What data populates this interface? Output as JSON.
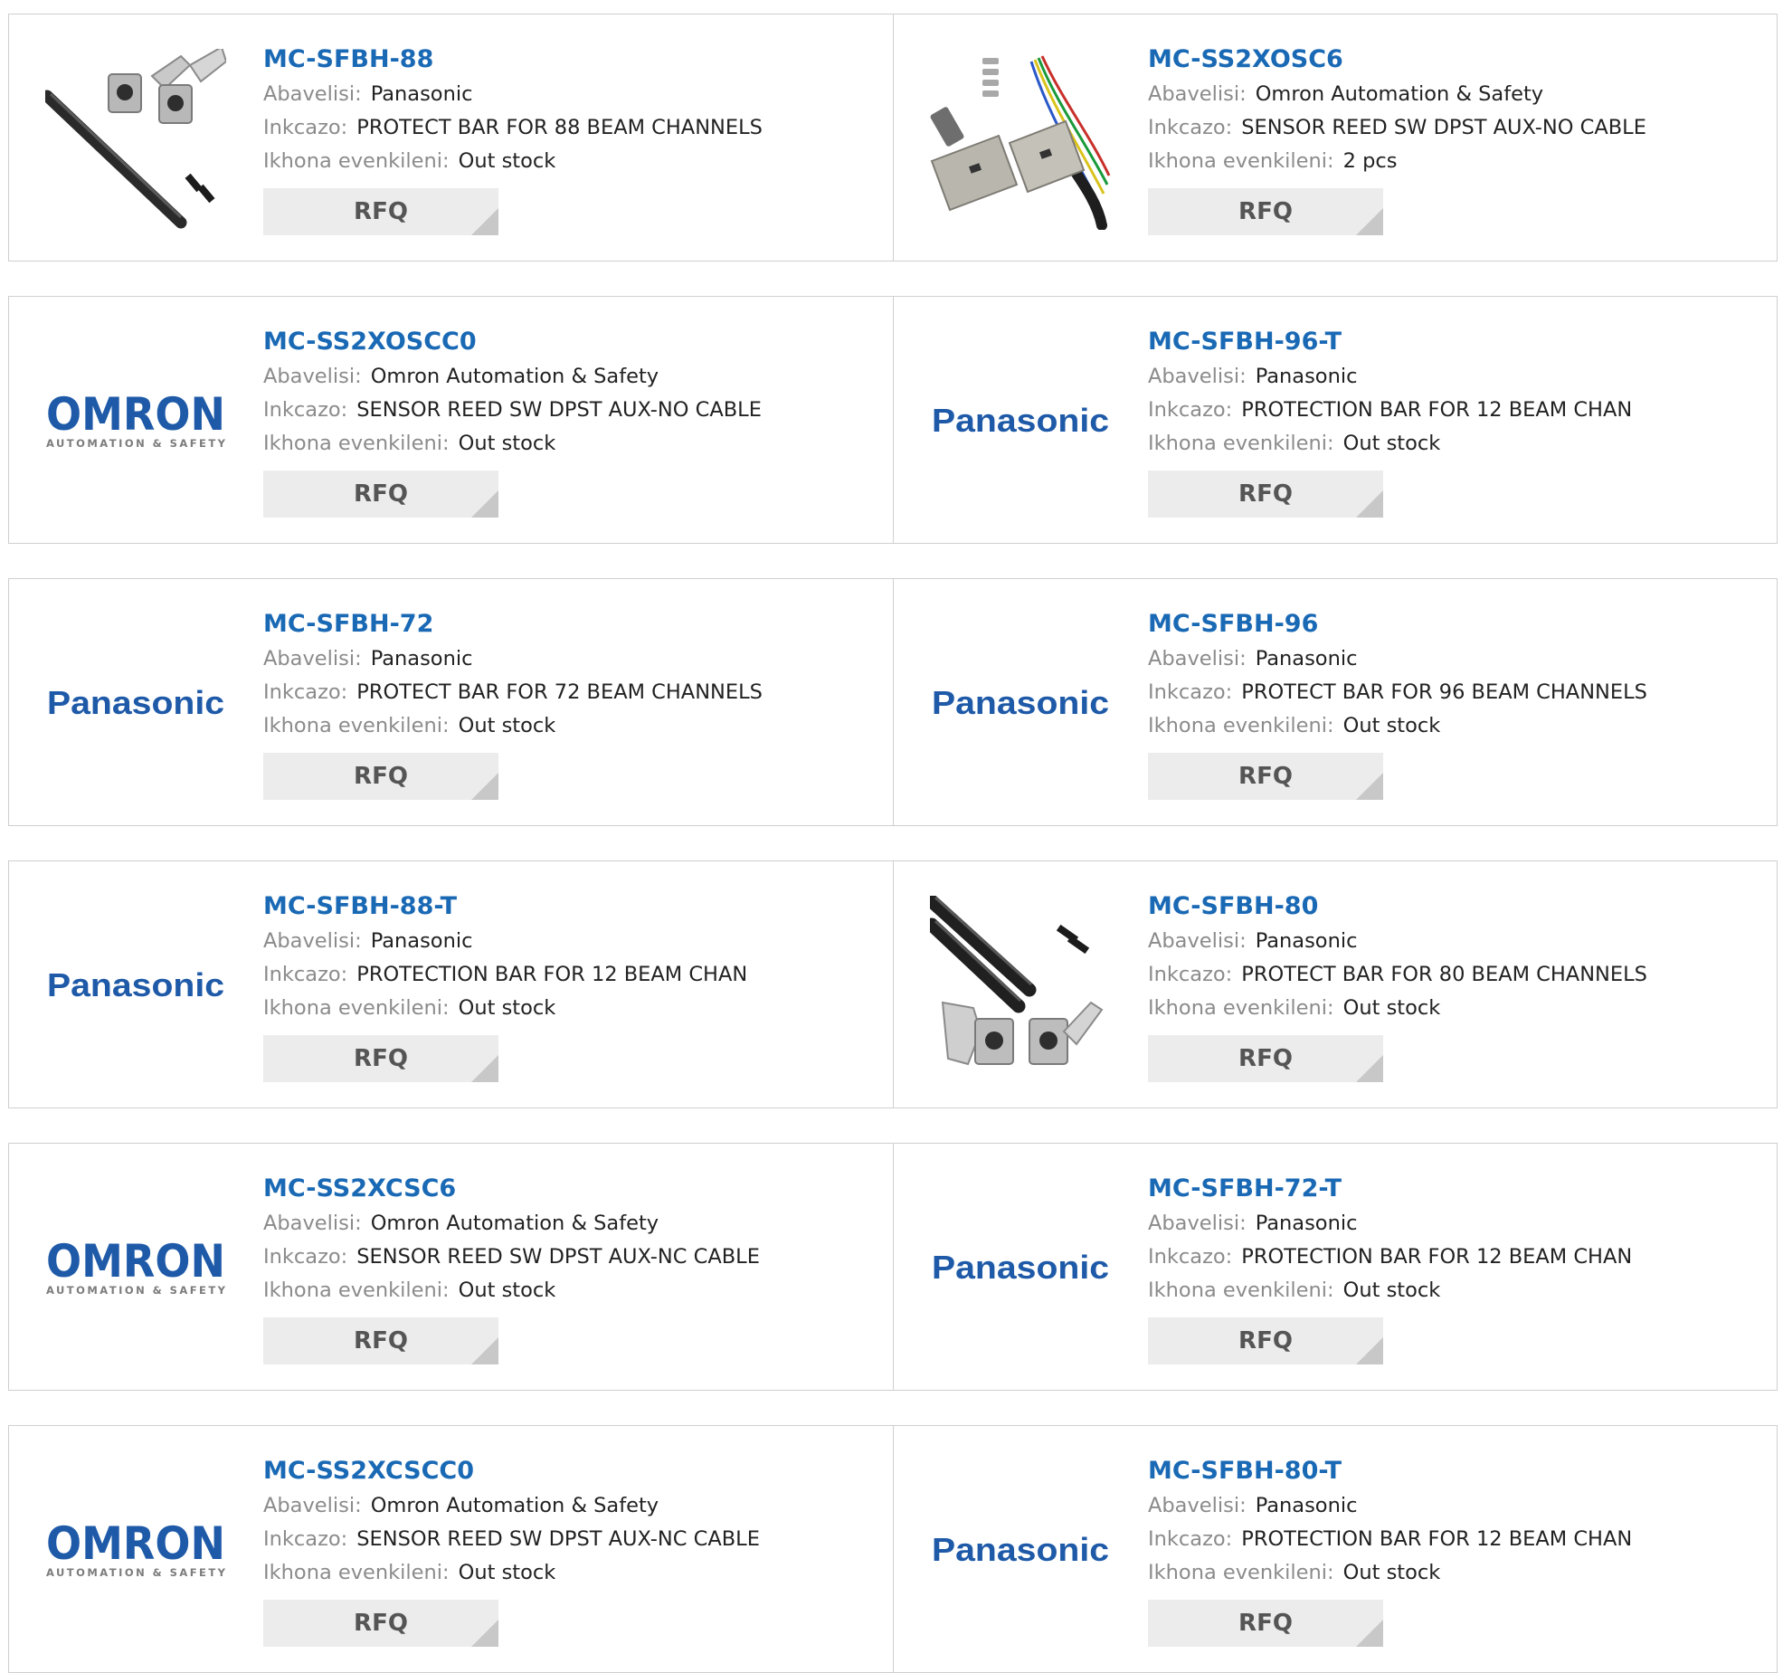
{
  "labels": {
    "manufacturer": "Abavelisi:",
    "description": "Inkcazo:",
    "stock": "Ikhona evenkileni:",
    "rfq": "RFQ"
  },
  "brand_logos": {
    "omron": {
      "name": "OMRON",
      "tagline": "AUTOMATION & SAFETY",
      "color": "#1e5aa8"
    },
    "panasonic": {
      "name": "Panasonic",
      "color": "#1e5aa8"
    }
  },
  "products": [
    {
      "part_number": "MC-SFBH-88",
      "manufacturer": "Panasonic",
      "description": "PROTECT BAR FOR 88 BEAM CHANNELS",
      "stock": "Out stock",
      "image": "bar-photo"
    },
    {
      "part_number": "MC-SS2XOSC6",
      "manufacturer": "Omron Automation & Safety",
      "description": "SENSOR REED SW DPST AUX-NO CABLE",
      "stock": "2 pcs",
      "image": "sensor-photo"
    },
    {
      "part_number": "MC-SS2XOSCC0",
      "manufacturer": "Omron Automation & Safety",
      "description": "SENSOR REED SW DPST AUX-NO CABLE",
      "stock": "Out stock",
      "image": "omron"
    },
    {
      "part_number": "MC-SFBH-96-T",
      "manufacturer": "Panasonic",
      "description": "PROTECTION BAR FOR 12 BEAM CHAN",
      "stock": "Out stock",
      "image": "panasonic"
    },
    {
      "part_number": "MC-SFBH-72",
      "manufacturer": "Panasonic",
      "description": "PROTECT BAR FOR 72 BEAM CHANNELS",
      "stock": "Out stock",
      "image": "panasonic"
    },
    {
      "part_number": "MC-SFBH-96",
      "manufacturer": "Panasonic",
      "description": "PROTECT BAR FOR 96 BEAM CHANNELS",
      "stock": "Out stock",
      "image": "panasonic"
    },
    {
      "part_number": "MC-SFBH-88-T",
      "manufacturer": "Panasonic",
      "description": "PROTECTION BAR FOR 12 BEAM CHAN",
      "stock": "Out stock",
      "image": "panasonic"
    },
    {
      "part_number": "MC-SFBH-80",
      "manufacturer": "Panasonic",
      "description": "PROTECT BAR FOR 80 BEAM CHANNELS",
      "stock": "Out stock",
      "image": "bars-photo"
    },
    {
      "part_number": "MC-SS2XCSC6",
      "manufacturer": "Omron Automation & Safety",
      "description": "SENSOR REED SW DPST AUX-NC CABLE",
      "stock": "Out stock",
      "image": "omron"
    },
    {
      "part_number": "MC-SFBH-72-T",
      "manufacturer": "Panasonic",
      "description": "PROTECTION BAR FOR 12 BEAM CHAN",
      "stock": "Out stock",
      "image": "panasonic"
    },
    {
      "part_number": "MC-SS2XCSCC0",
      "manufacturer": "Omron Automation & Safety",
      "description": "SENSOR REED SW DPST AUX-NC CABLE",
      "stock": "Out stock",
      "image": "omron"
    },
    {
      "part_number": "MC-SFBH-80-T",
      "manufacturer": "Panasonic",
      "description": "PROTECTION BAR FOR 12 BEAM CHAN",
      "stock": "Out stock",
      "image": "panasonic"
    }
  ]
}
